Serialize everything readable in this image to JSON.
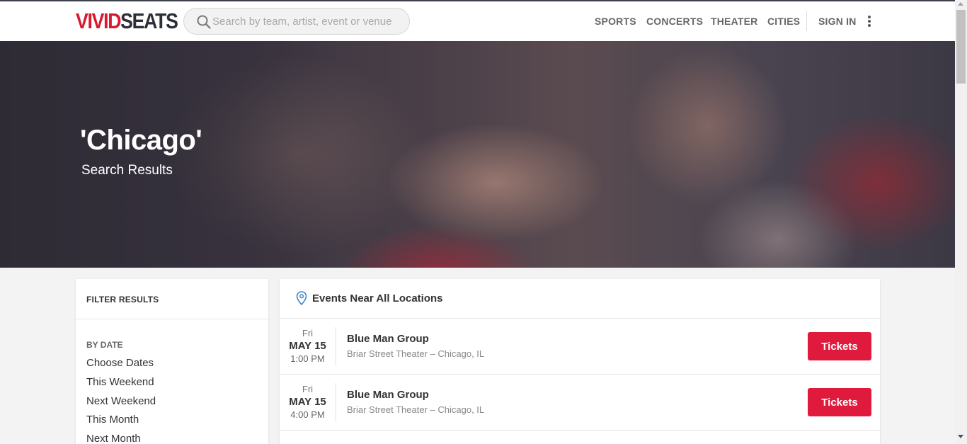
{
  "header": {
    "logo_vivid": "VIVID",
    "logo_seats": "SEATS",
    "search_placeholder": "Search by team, artist, event or venue",
    "nav": [
      "SPORTS",
      "CONCERTS",
      "THEATER",
      "CITIES",
      "SIGN IN"
    ],
    "more_icon": "more-vertical-icon"
  },
  "hero": {
    "title": "'Chicago'",
    "subtitle": "Search Results"
  },
  "filter": {
    "heading": "FILTER RESULTS",
    "by_date_label": "BY DATE",
    "options": [
      "Choose Dates",
      "This Weekend",
      "Next Weekend",
      "This Month",
      "Next Month"
    ]
  },
  "events": {
    "heading": "Events Near All Locations",
    "heading_icon": "location-pin-icon",
    "items": [
      {
        "dow": "Fri",
        "date": "MAY 15",
        "time": "1:00 PM",
        "name": "Blue Man Group",
        "venue": "Briar Street Theater – Chicago, IL",
        "button": "Tickets"
      },
      {
        "dow": "Fri",
        "date": "MAY 15",
        "time": "4:00 PM",
        "name": "Blue Man Group",
        "venue": "Briar Street Theater – Chicago, IL",
        "button": "Tickets"
      }
    ]
  },
  "colors": {
    "brand_red": "#d8192f",
    "button_red": "#e01a3c",
    "logo_dark": "#2c2f38"
  }
}
